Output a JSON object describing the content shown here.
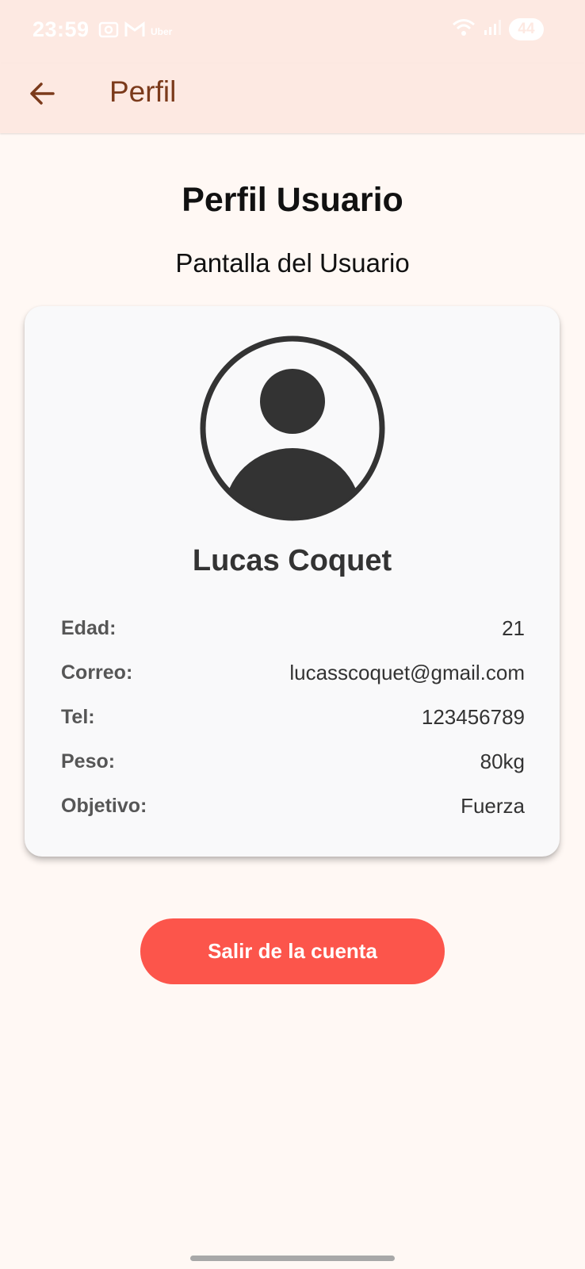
{
  "status_bar": {
    "time": "23:59",
    "notification_icons": [
      "screenshot-icon",
      "gmail-icon",
      "uber-icon"
    ],
    "uber_label": "Uber",
    "battery": "44"
  },
  "app_bar": {
    "title": "Perfil",
    "back_icon": "arrow-back-icon"
  },
  "page": {
    "heading": "Perfil Usuario",
    "subheading": "Pantalla del Usuario"
  },
  "profile": {
    "avatar_icon": "account-circle-icon",
    "name": "Lucas Coquet",
    "fields": [
      {
        "label": "Edad:",
        "value": "21"
      },
      {
        "label": "Correo:",
        "value": "lucasscoquet@gmail.com"
      },
      {
        "label": "Tel:",
        "value": "123456789"
      },
      {
        "label": "Peso:",
        "value": "80kg"
      },
      {
        "label": "Objetivo:",
        "value": "Fuerza"
      }
    ]
  },
  "logout_label": "Salir de la cuenta",
  "colors": {
    "app_bar_bg": "#fde9e2",
    "page_bg": "#fff8f4",
    "title_brown": "#7b3a1b",
    "card_bg": "#f9f9fa",
    "logout_red": "#fc554b",
    "avatar_dark": "#333333"
  }
}
